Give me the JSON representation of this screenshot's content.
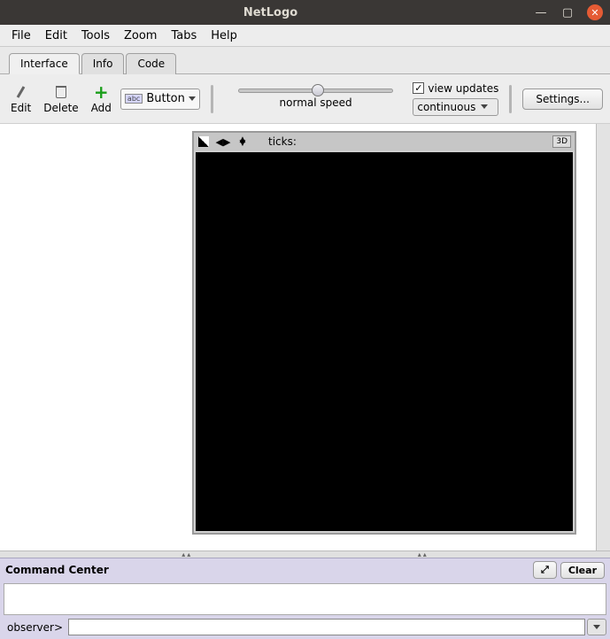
{
  "window": {
    "title": "NetLogo"
  },
  "menubar": {
    "file": "File",
    "edit": "Edit",
    "tools": "Tools",
    "zoom": "Zoom",
    "tabs": "Tabs",
    "help": "Help"
  },
  "tabs": {
    "interface": "Interface",
    "info": "Info",
    "code": "Code"
  },
  "toolbar": {
    "edit": "Edit",
    "delete": "Delete",
    "add": "Add",
    "button_sel_abc": "abc",
    "button_sel_label": "Button",
    "speed_label": "normal speed",
    "view_updates": "view updates",
    "update_mode": "continuous",
    "settings": "Settings..."
  },
  "view": {
    "ticks_label": "ticks:",
    "ticks_value": "",
    "three_d": "3D"
  },
  "cmd": {
    "title": "Command Center",
    "expand_icon": "⤢",
    "clear": "Clear",
    "observer_prompt": "observer>",
    "input_value": ""
  }
}
